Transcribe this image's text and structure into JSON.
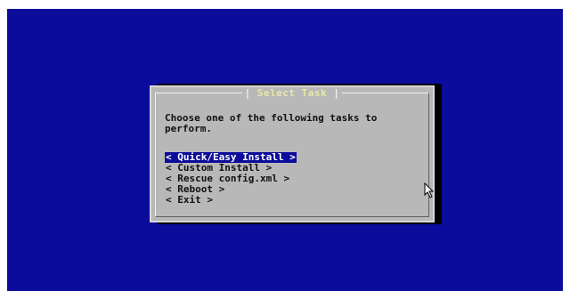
{
  "screen": {
    "background": "#0c0c9c"
  },
  "dialog": {
    "title": "Select Task",
    "title_left": "|",
    "title_right": "|",
    "prompt": "Choose one of the following tasks to\nperform.",
    "menu_items": [
      {
        "label": "< Quick/Easy Install >",
        "selected": true
      },
      {
        "label": "< Custom Install >",
        "selected": false
      },
      {
        "label": "< Rescue config.xml >",
        "selected": false
      },
      {
        "label": "< Reboot >",
        "selected": false
      },
      {
        "label": "< Exit >",
        "selected": false
      }
    ]
  },
  "cursor": {
    "icon": "mouse-pointer-icon"
  }
}
